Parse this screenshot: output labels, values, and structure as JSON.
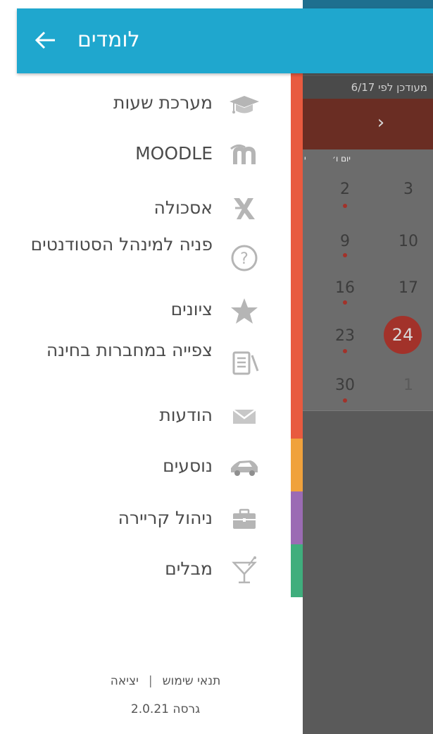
{
  "app_bar": {
    "title": "לומדים",
    "back_icon": "arrow-back-icon"
  },
  "background_screen": {
    "updated_text": "מעודכן לפי 6/17",
    "next_arrow": "›",
    "day_header": "יום ו׳",
    "day_header_partial": "י",
    "calendar_numbers": [
      "2",
      "3",
      "9",
      "10",
      "16",
      "17",
      "23",
      "24",
      "30",
      "1"
    ],
    "today": "24"
  },
  "menu": {
    "items": [
      {
        "id": "timetable",
        "label": "מערכת שעות",
        "icon": "graduation-cap-icon"
      },
      {
        "id": "moodle",
        "label": "MOODLE",
        "icon": "moodle-icon"
      },
      {
        "id": "eschola",
        "label": "אסכולה",
        "icon": "eschola-icon"
      },
      {
        "id": "student-affairs",
        "label": "פניה למינהל הסטודנטים",
        "icon": "question-icon"
      },
      {
        "id": "grades",
        "label": "ציונים",
        "icon": "star-icon"
      },
      {
        "id": "exam-notebooks",
        "label": "צפייה במחברות בחינה",
        "icon": "notebook-icon"
      },
      {
        "id": "messages",
        "label": "הודעות",
        "icon": "envelope-icon"
      },
      {
        "id": "rides",
        "label": "נוסעים",
        "icon": "car-icon"
      },
      {
        "id": "career",
        "label": "ניהול קריירה",
        "icon": "briefcase-icon"
      },
      {
        "id": "mablim",
        "label": "מבלים",
        "icon": "cocktail-icon"
      }
    ]
  },
  "footer": {
    "terms": "תנאי שימוש",
    "separator": "|",
    "logout": "יציאה",
    "version": "גרסה 2.0.21"
  },
  "colors": {
    "header": "#1fa7ce",
    "strip_red": "#e85a3f",
    "strip_orange": "#f0a23c",
    "strip_purple": "#9b6bb4",
    "strip_green": "#3fae7d",
    "icon_gray": "#b5b5b5",
    "accent_red": "#a2322a"
  }
}
